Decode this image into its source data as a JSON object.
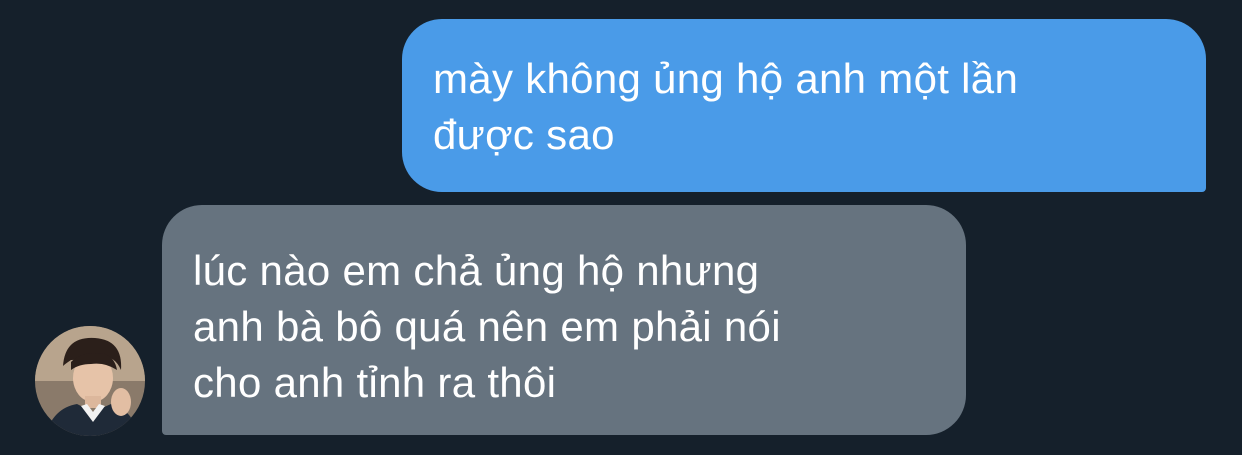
{
  "conversation": {
    "messages": [
      {
        "sender": "me",
        "text": "mày không ủng hộ anh một lần\nđược sao"
      },
      {
        "sender": "contact",
        "text": "lúc nào em chả ủng hộ nhưng\nanh bà bô quá nên em phải nói\ncho anh tỉnh ra thôi"
      }
    ]
  },
  "colors": {
    "background": "#15202b",
    "sent_bubble": "#4a9be8",
    "received_bubble": "#66737f",
    "text": "#ffffff"
  }
}
